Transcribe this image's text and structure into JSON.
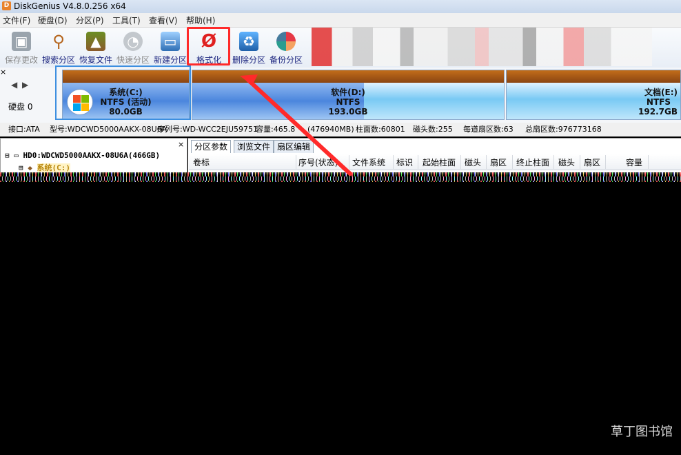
{
  "app": {
    "title": "DiskGenius V4.8.0.256 x64",
    "icon_text": "D"
  },
  "menu": [
    {
      "label": "文件(F)"
    },
    {
      "label": "硬盘(D)"
    },
    {
      "label": "分区(P)"
    },
    {
      "label": "工具(T)"
    },
    {
      "label": "查看(V)"
    },
    {
      "label": "帮助(H)"
    }
  ],
  "toolbar": [
    {
      "label": "保存更改",
      "icon": "save-disk-icon",
      "enabled": false
    },
    {
      "label": "搜索分区",
      "icon": "magnifier-icon",
      "enabled": true
    },
    {
      "label": "恢复文件",
      "icon": "recover-box-icon",
      "enabled": true
    },
    {
      "label": "快速分区",
      "icon": "quick-partition-disk-icon",
      "enabled": false
    },
    {
      "label": "新建分区",
      "icon": "new-partition-laptop-icon",
      "enabled": true
    },
    {
      "label": "格式化",
      "icon": "format-null-icon",
      "enabled": true
    },
    {
      "label": "删除分区",
      "icon": "recycle-bin-icon",
      "enabled": true
    },
    {
      "label": "备份分区",
      "icon": "backup-pie-icon",
      "enabled": true
    }
  ],
  "disk": {
    "nav_prev": "◀",
    "nav_next": "▶",
    "label": "硬盘 0",
    "partitions": [
      {
        "name": "系统(C:)",
        "fs": "NTFS (活动)",
        "size": "80.0GB",
        "used_fraction": 1.0
      },
      {
        "name": "软件(D:)",
        "fs": "NTFS",
        "size": "193.0GB",
        "used_fraction": 0.55
      },
      {
        "name": "文档(E:)",
        "fs": "NTFS",
        "size": "192.7GB",
        "used_fraction": 0.0
      }
    ]
  },
  "info": {
    "interface": "接口:ATA",
    "model": "型号:WDCWD5000AAKX-08U6A",
    "serial": "序列号:WD-WCC2EJU59751",
    "capacity": "容量:465.8",
    "capacity_mb": "(476940MB)",
    "cylinders": "柱面数:60801",
    "heads": "磁头数:255",
    "sectors_per_track": "每道扇区数:63",
    "total_sectors": "总扇区数:976773168"
  },
  "tree": {
    "close": "×",
    "disk_node": "HD0:WDCWD5000AAKX-08U6A(466GB)",
    "partition_node": "系统(C:)"
  },
  "tabs": [
    {
      "label": "分区参数",
      "active": true
    },
    {
      "label": "浏览文件",
      "active": false
    },
    {
      "label": "扇区编辑",
      "active": false
    }
  ],
  "columns": [
    "卷标",
    "序号(状态)",
    "文件系统",
    "标识",
    "起始柱面",
    "磁头",
    "扇区",
    "终止柱面",
    "磁头",
    "扇区",
    "容量"
  ],
  "colors": {
    "highlight": "#ff2a2a",
    "selection": "#3d8fe0",
    "partition_bar": "#a6581a"
  },
  "watermark": "草丁图书馆"
}
